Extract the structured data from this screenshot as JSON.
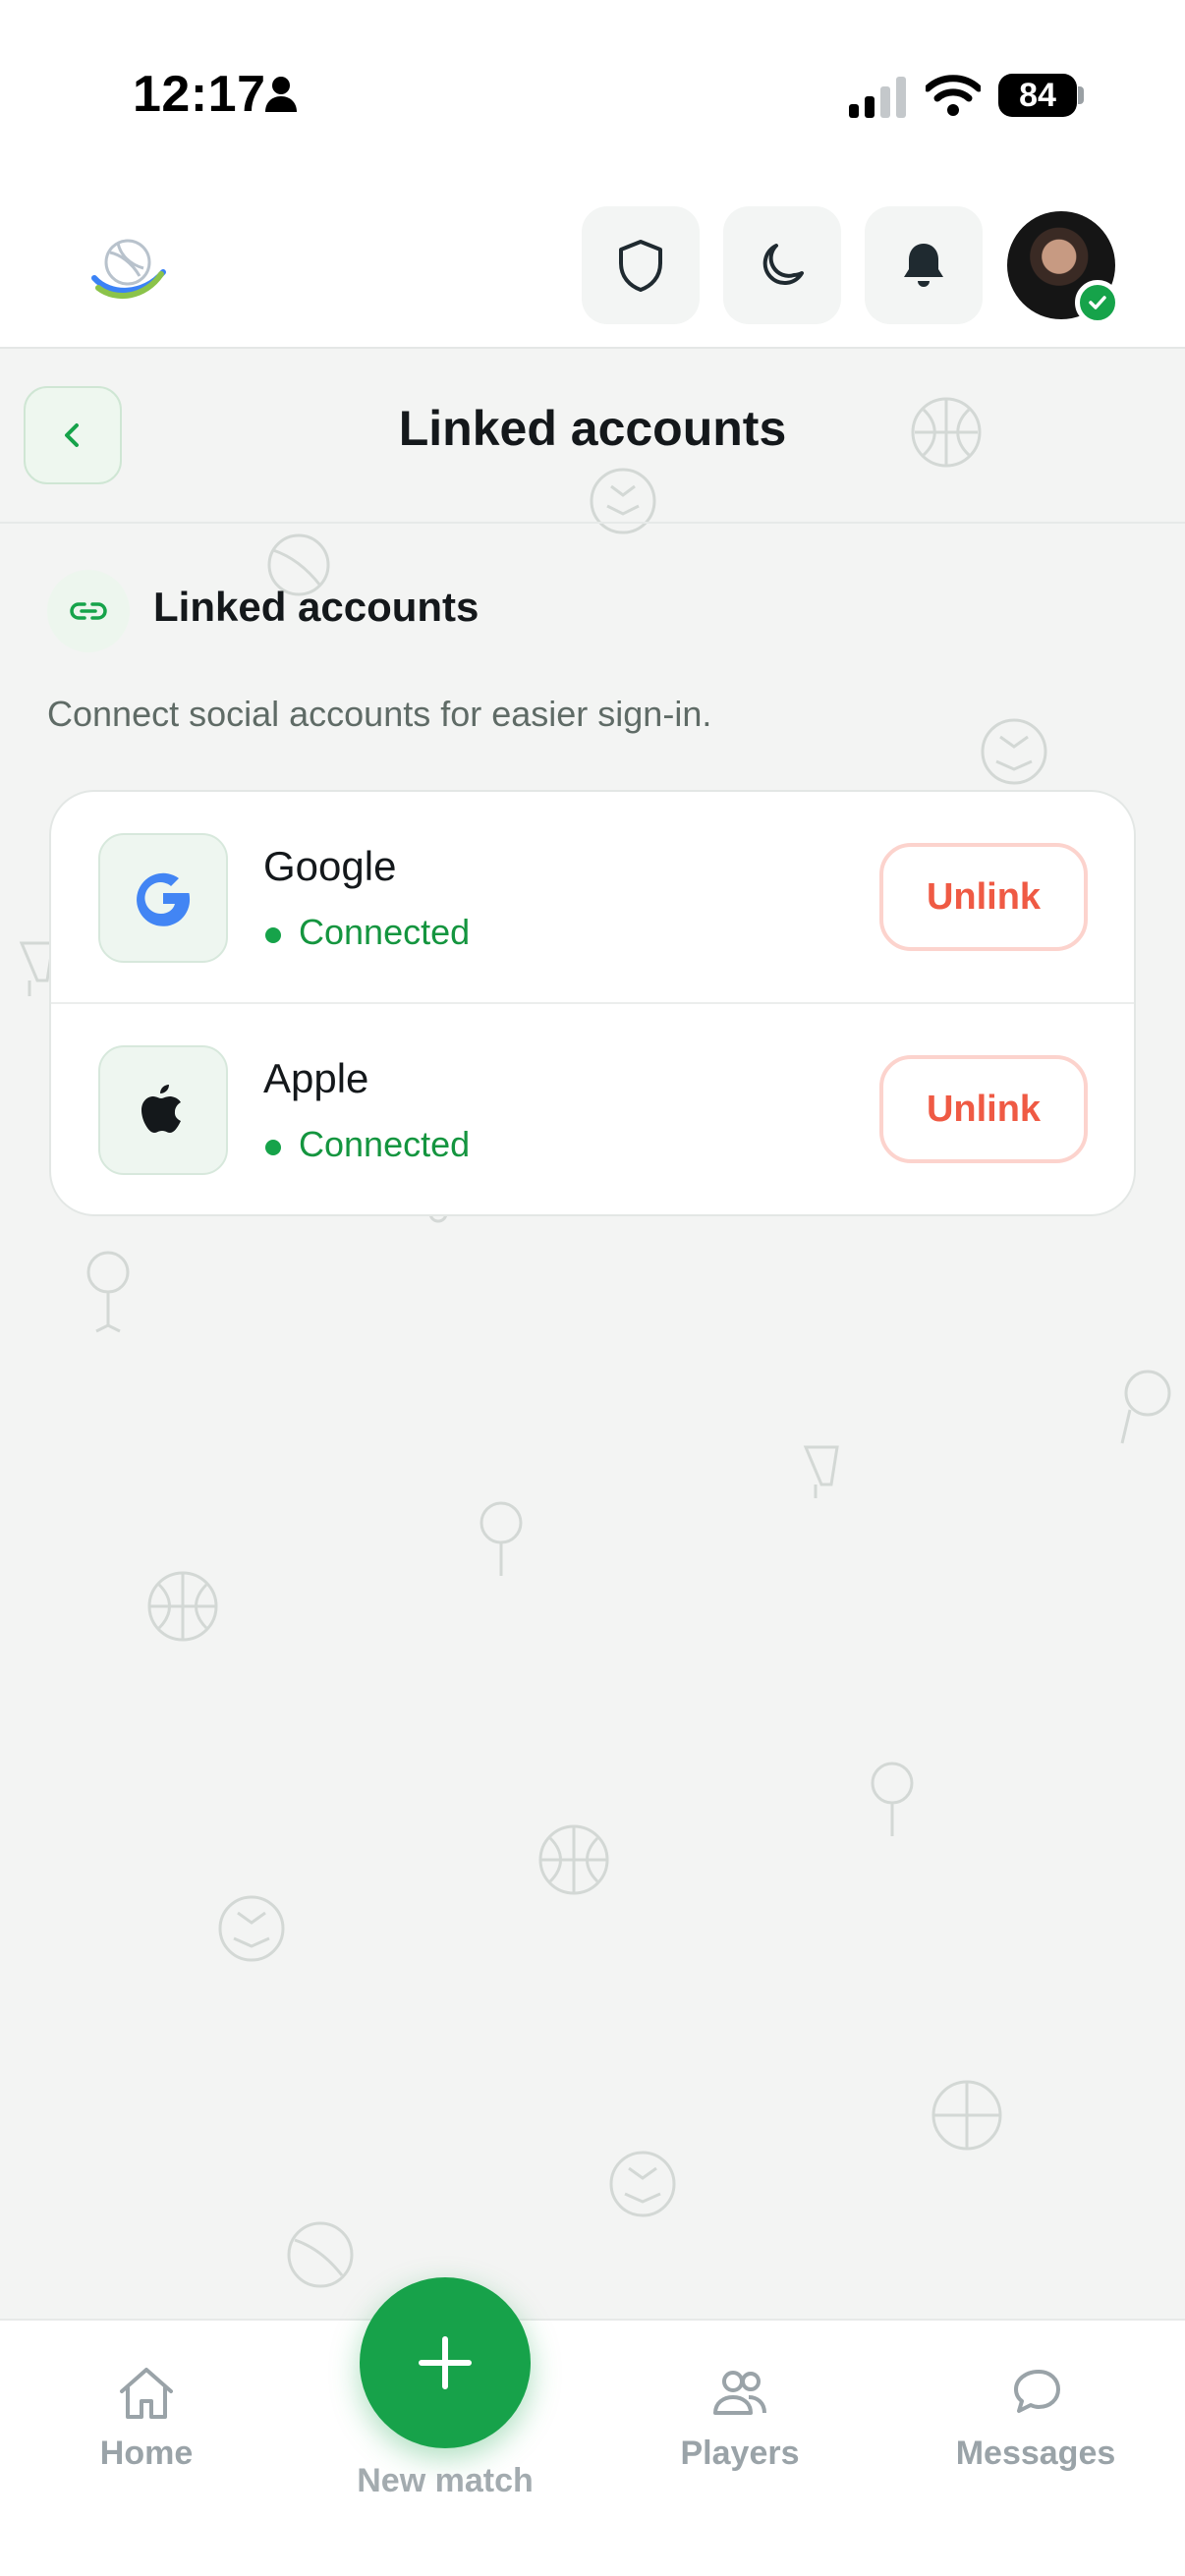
{
  "status_bar": {
    "time": "12:17",
    "battery": "84"
  },
  "header": {
    "icons": [
      "shield-icon",
      "moon-icon",
      "bell-icon"
    ],
    "online_color": "#16a34a"
  },
  "page": {
    "title": "Linked accounts"
  },
  "section": {
    "title": "Linked accounts",
    "description": "Connect social accounts for easier sign-in."
  },
  "accounts": [
    {
      "provider": "Google",
      "status": "Connected",
      "action": "Unlink",
      "icon": "google-icon"
    },
    {
      "provider": "Apple",
      "status": "Connected",
      "action": "Unlink",
      "icon": "apple-icon"
    }
  ],
  "bottom_nav": {
    "home": "Home",
    "new_match": "New match",
    "players": "Players",
    "messages": "Messages"
  },
  "colors": {
    "accent": "#17a24a",
    "danger": "#ef5a44",
    "background": "#f3f4f3"
  }
}
